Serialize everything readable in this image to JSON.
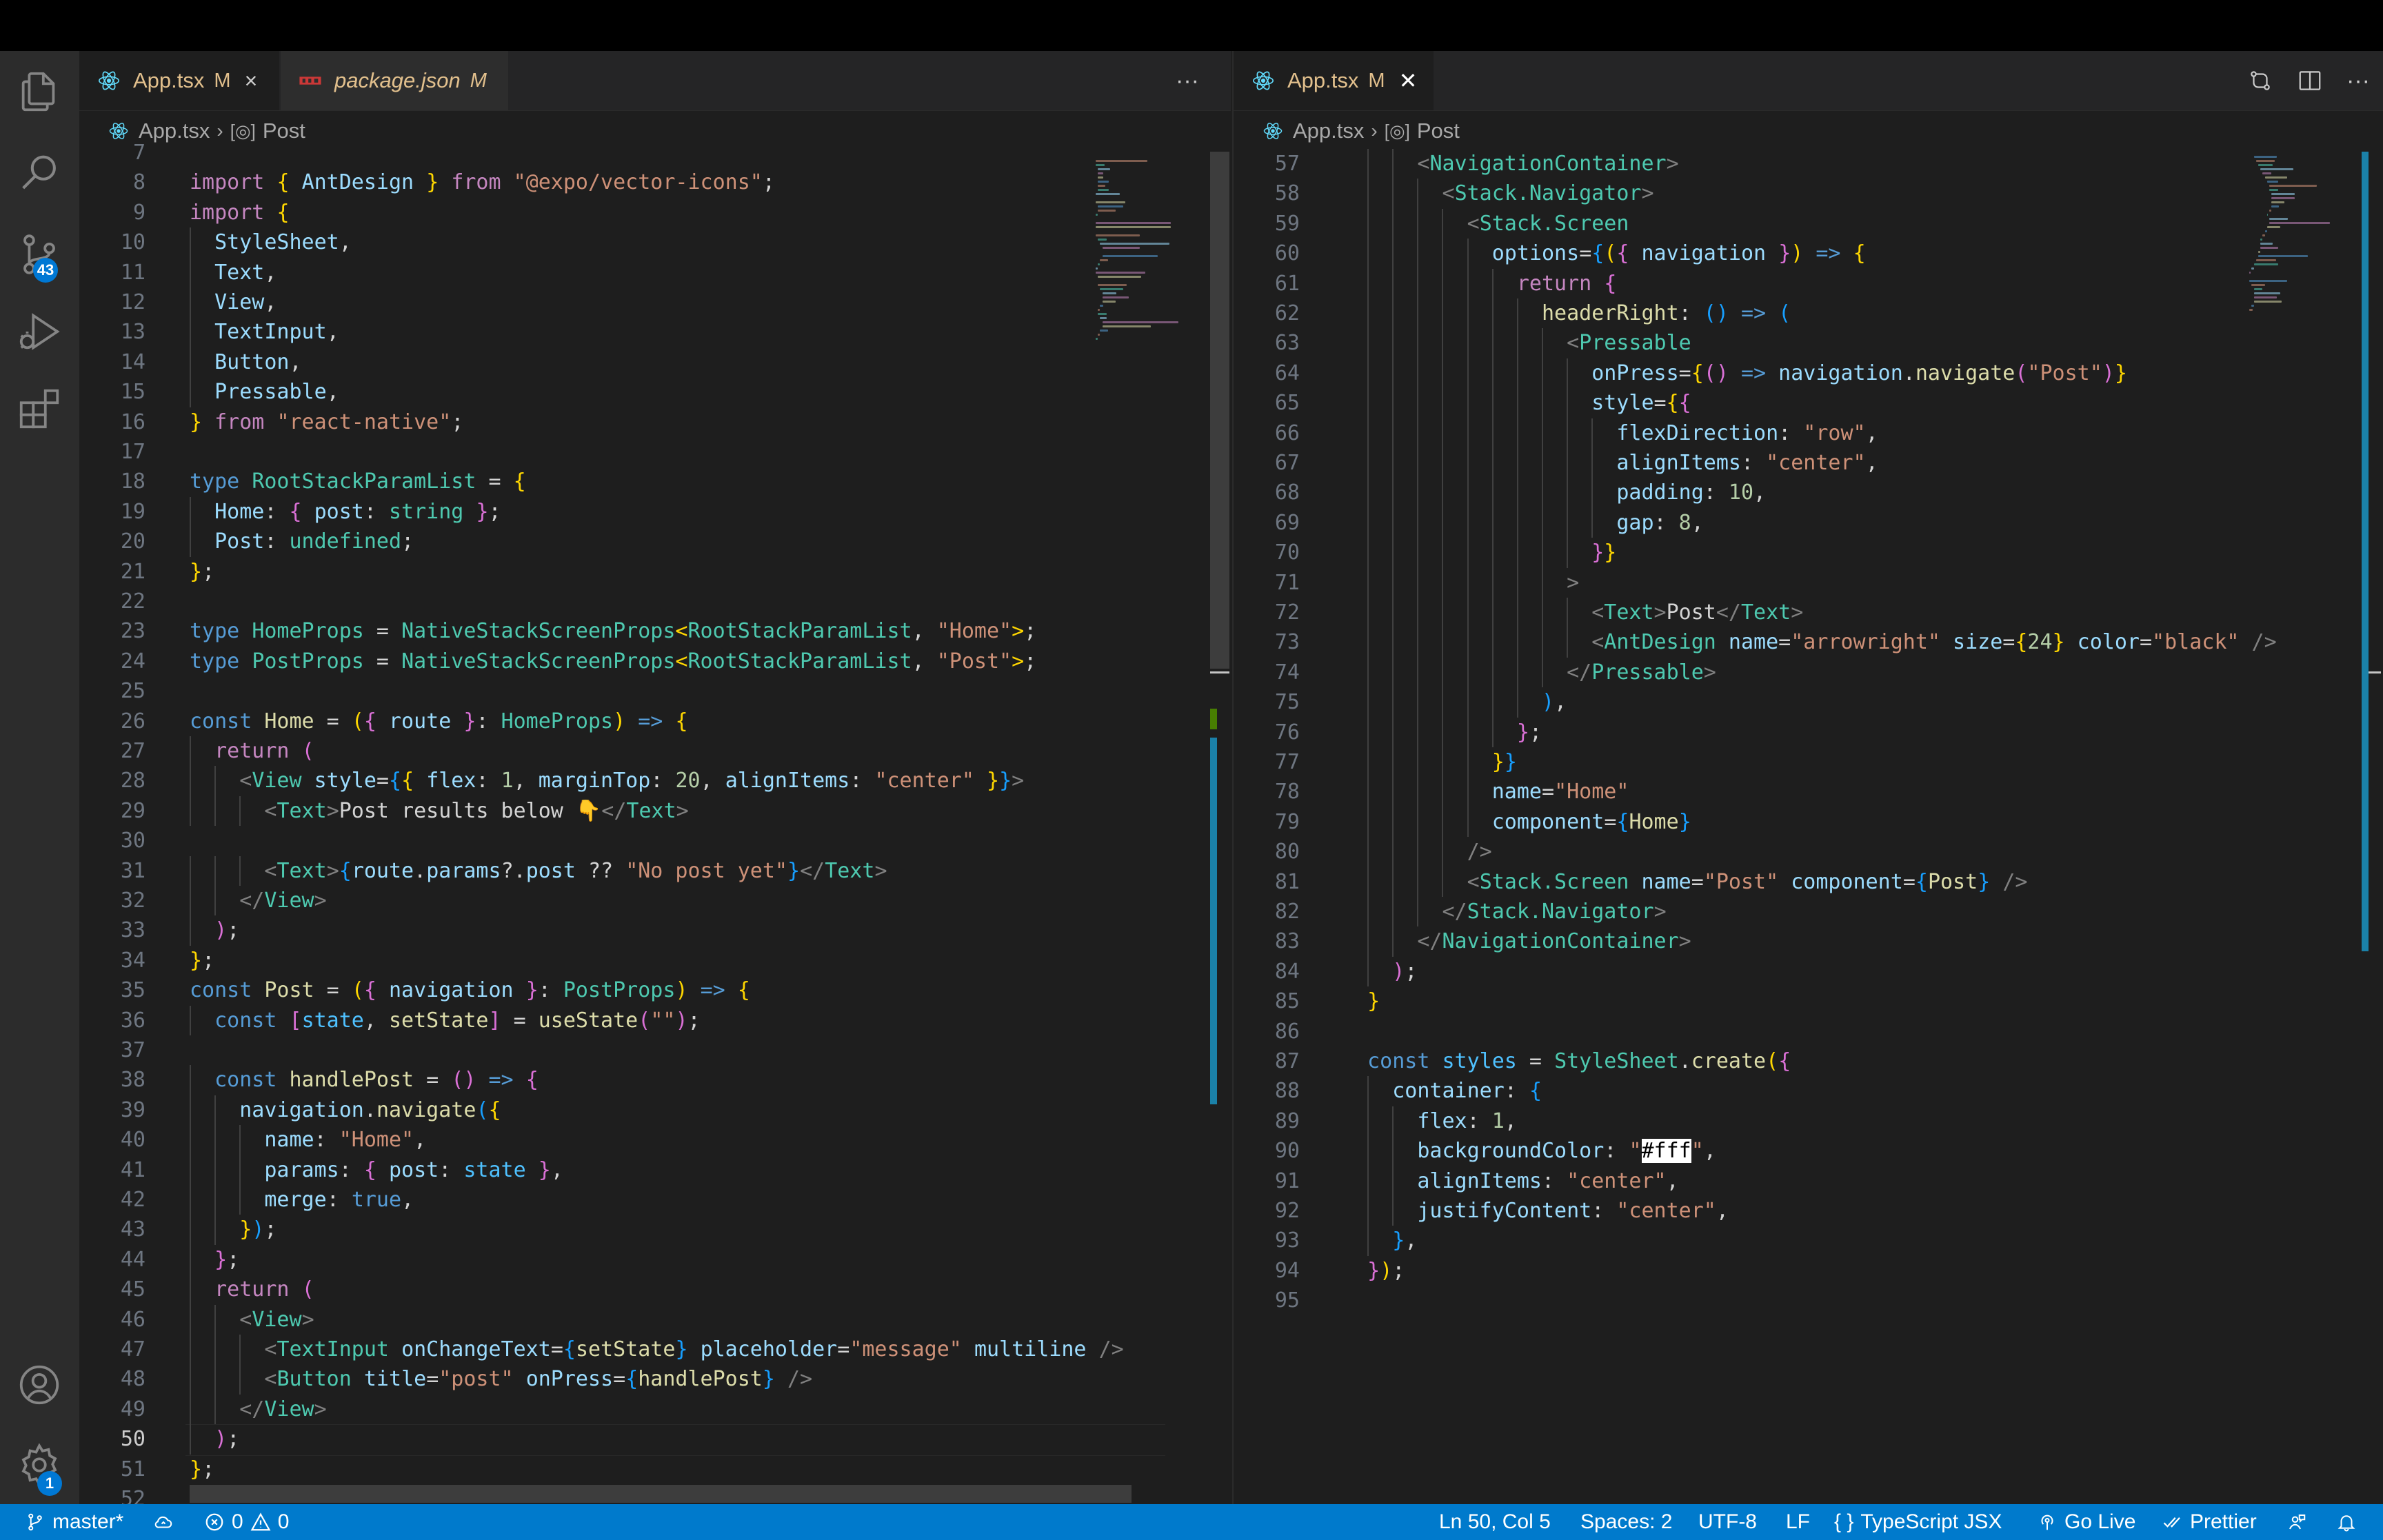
{
  "colors": {
    "accent": "#007acc",
    "modified": "#e2c08d",
    "badge": "#0078d4"
  },
  "activity_bar": {
    "items": [
      {
        "name": "explorer-icon"
      },
      {
        "name": "search-icon"
      },
      {
        "name": "source-control-icon",
        "badge": "43"
      },
      {
        "name": "run-debug-icon"
      },
      {
        "name": "extensions-icon"
      }
    ],
    "bottom": [
      {
        "name": "account-icon"
      },
      {
        "name": "manage-gear-icon",
        "badge": "1"
      }
    ]
  },
  "left_editor": {
    "tabs": [
      {
        "label": "App.tsx",
        "modified": "M",
        "active": true
      },
      {
        "label": "package.json",
        "modified": "M",
        "active": false
      }
    ],
    "more_actions": "···",
    "breadcrumb": {
      "file": "App.tsx",
      "symbol": "Post"
    },
    "current_line": 50,
    "lines": [
      {
        "num": "7",
        "html": ""
      },
      {
        "num": "8",
        "html": "<span class=\"c\">import</span> <span class=\"b1\">{</span> <span class=\"v\">AntDesign</span> <span class=\"b1\">}</span> <span class=\"c\">from</span> <span class=\"s\">\"@expo/vector-icons\"</span>;"
      },
      {
        "num": "9",
        "html": "<span class=\"c\">import</span> <span class=\"b1\">{</span>"
      },
      {
        "num": "10",
        "html": "  <span class=\"v\">StyleSheet</span>,"
      },
      {
        "num": "11",
        "html": "  <span class=\"v\">Text</span>,"
      },
      {
        "num": "12",
        "html": "  <span class=\"v\">View</span>,"
      },
      {
        "num": "13",
        "html": "  <span class=\"v\">TextInput</span>,"
      },
      {
        "num": "14",
        "html": "  <span class=\"v\">Button</span>,"
      },
      {
        "num": "15",
        "html": "  <span class=\"v\">Pressable</span>,"
      },
      {
        "num": "16",
        "html": "<span class=\"b1\">}</span> <span class=\"c\">from</span> <span class=\"s\">\"react-native\"</span>;"
      },
      {
        "num": "17",
        "html": ""
      },
      {
        "num": "18",
        "html": "<span class=\"k\">type</span> <span class=\"t\">RootStackParamList</span> = <span class=\"b1\">{</span>"
      },
      {
        "num": "19",
        "html": "  <span class=\"v\">Home</span>: <span class=\"b2\">{</span> <span class=\"v\">post</span>: <span class=\"t\">string</span> <span class=\"b2\">}</span>;"
      },
      {
        "num": "20",
        "html": "  <span class=\"v\">Post</span>: <span class=\"t\">undefined</span>;"
      },
      {
        "num": "21",
        "html": "<span class=\"b1\">}</span>;"
      },
      {
        "num": "22",
        "html": ""
      },
      {
        "num": "23",
        "html": "<span class=\"k\">type</span> <span class=\"t\">HomeProps</span> = <span class=\"t\">NativeStackScreenProps</span><span class=\"b1\">&lt;</span><span class=\"t\">RootStackParamList</span>, <span class=\"s\">\"Home\"</span><span class=\"b1\">&gt;</span>;"
      },
      {
        "num": "24",
        "html": "<span class=\"k\">type</span> <span class=\"t\">PostProps</span> = <span class=\"t\">NativeStackScreenProps</span><span class=\"b1\">&lt;</span><span class=\"t\">RootStackParamList</span>, <span class=\"s\">\"Post\"</span><span class=\"b1\">&gt;</span>;"
      },
      {
        "num": "25",
        "html": ""
      },
      {
        "num": "26",
        "html": "<span class=\"k\">const</span> <span class=\"f\">Home</span> = <span class=\"b1\">(</span><span class=\"b2\">{</span> <span class=\"v\">route</span> <span class=\"b2\">}</span>: <span class=\"t\">HomeProps</span><span class=\"b1\">)</span> <span class=\"k\">=&gt;</span> <span class=\"b1\">{</span>"
      },
      {
        "num": "27",
        "html": "  <span class=\"c\">return</span> <span class=\"b2\">(</span>"
      },
      {
        "num": "28",
        "html": "    <span class=\"tg\">&lt;</span><span class=\"t\">View</span> <span class=\"v\">style</span>=<span class=\"b3\">{</span><span class=\"b1\">{</span> <span class=\"v\">flex</span>: <span class=\"n\">1</span>, <span class=\"v\">marginTop</span>: <span class=\"n\">20</span>, <span class=\"v\">alignItems</span>: <span class=\"s\">\"center\"</span> <span class=\"b1\">}</span><span class=\"b3\">}</span><span class=\"tg\">&gt;</span>"
      },
      {
        "num": "29",
        "html": "      <span class=\"tg\">&lt;</span><span class=\"t\">Text</span><span class=\"tg\">&gt;</span>Post results below 👇<span class=\"tg\">&lt;/</span><span class=\"t\">Text</span><span class=\"tg\">&gt;</span>"
      },
      {
        "num": "30",
        "html": ""
      },
      {
        "num": "31",
        "html": "      <span class=\"tg\">&lt;</span><span class=\"t\">Text</span><span class=\"tg\">&gt;</span><span class=\"b3\">{</span><span class=\"v\">route</span>.<span class=\"v\">params</span>?.<span class=\"v\">post</span> ?? <span class=\"s\">\"No post yet\"</span><span class=\"b3\">}</span><span class=\"tg\">&lt;/</span><span class=\"t\">Text</span><span class=\"tg\">&gt;</span>"
      },
      {
        "num": "32",
        "html": "    <span class=\"tg\">&lt;/</span><span class=\"t\">View</span><span class=\"tg\">&gt;</span>"
      },
      {
        "num": "33",
        "html": "  <span class=\"b2\">)</span>;"
      },
      {
        "num": "34",
        "html": "<span class=\"b1\">}</span>;"
      },
      {
        "num": "35",
        "html": "<span class=\"k\">const</span> <span class=\"f\">Post</span> = <span class=\"b1\">(</span><span class=\"b2\">{</span> <span class=\"v\">navigation</span> <span class=\"b2\">}</span>: <span class=\"t\">PostProps</span><span class=\"b1\">)</span> <span class=\"k\">=&gt;</span> <span class=\"b1\">{</span>"
      },
      {
        "num": "36",
        "html": "  <span class=\"k\">const</span> <span class=\"b2\">[</span><span class=\"vv\">state</span>, <span class=\"f\">setState</span><span class=\"b2\">]</span> = <span class=\"f\">useState</span><span class=\"b2\">(</span><span class=\"s\">\"\"</span><span class=\"b2\">)</span>;"
      },
      {
        "num": "37",
        "html": ""
      },
      {
        "num": "38",
        "html": "  <span class=\"k\">const</span> <span class=\"f\">handlePost</span> = <span class=\"b2\">()</span> <span class=\"k\">=&gt;</span> <span class=\"b2\">{</span>"
      },
      {
        "num": "39",
        "html": "    <span class=\"v\">navigation</span>.<span class=\"f\">navigate</span><span class=\"b3\">(</span><span class=\"b1\">{</span>"
      },
      {
        "num": "40",
        "html": "      <span class=\"v\">name</span>: <span class=\"s\">\"Home\"</span>,"
      },
      {
        "num": "41",
        "html": "      <span class=\"v\">params</span>: <span class=\"b2\">{</span> <span class=\"v\">post</span>: <span class=\"vv\">state</span> <span class=\"b2\">}</span>,"
      },
      {
        "num": "42",
        "html": "      <span class=\"v\">merge</span>: <span class=\"k\">true</span>,"
      },
      {
        "num": "43",
        "html": "    <span class=\"b1\">}</span><span class=\"b3\">)</span>;"
      },
      {
        "num": "44",
        "html": "  <span class=\"b2\">}</span>;"
      },
      {
        "num": "45",
        "html": "  <span class=\"c\">return</span> <span class=\"b2\">(</span>"
      },
      {
        "num": "46",
        "html": "    <span class=\"tg\">&lt;</span><span class=\"t\">View</span><span class=\"tg\">&gt;</span>"
      },
      {
        "num": "47",
        "html": "      <span class=\"tg\">&lt;</span><span class=\"t\">TextInput</span> <span class=\"v\">onChangeText</span>=<span class=\"b3\">{</span><span class=\"f\">setState</span><span class=\"b3\">}</span> <span class=\"v\">placeholder</span>=<span class=\"s\">\"message\"</span> <span class=\"v\">multiline</span> <span class=\"tg\">/&gt;</span>"
      },
      {
        "num": "48",
        "html": "      <span class=\"tg\">&lt;</span><span class=\"t\">Button</span> <span class=\"v\">title</span>=<span class=\"s\">\"post\"</span> <span class=\"v\">onPress</span>=<span class=\"b3\">{</span><span class=\"f\">handlePost</span><span class=\"b3\">}</span> <span class=\"tg\">/&gt;</span>"
      },
      {
        "num": "49",
        "html": "    <span class=\"tg\">&lt;/</span><span class=\"t\">View</span><span class=\"tg\">&gt;</span>"
      },
      {
        "num": "50",
        "html": "  <span class=\"b2\">)</span>;"
      },
      {
        "num": "51",
        "html": "<span class=\"b1\">}</span>;"
      },
      {
        "num": "52",
        "html": ""
      }
    ]
  },
  "right_editor": {
    "tabs": [
      {
        "label": "App.tsx",
        "modified": "M",
        "active": true
      }
    ],
    "breadcrumb": {
      "file": "App.tsx",
      "symbol": "Post"
    },
    "lines": [
      {
        "num": "57",
        "html": "      <span class=\"tg\">&lt;</span><span class=\"t\">NavigationContainer</span><span class=\"tg\">&gt;</span>"
      },
      {
        "num": "58",
        "html": "        <span class=\"tg\">&lt;</span><span class=\"t\">Stack.Navigator</span><span class=\"tg\">&gt;</span>"
      },
      {
        "num": "59",
        "html": "          <span class=\"tg\">&lt;</span><span class=\"t\">Stack.Screen</span>"
      },
      {
        "num": "60",
        "html": "            <span class=\"v\">options</span>=<span class=\"b3\">{</span><span class=\"b1\">(</span><span class=\"b2\">{</span> <span class=\"v\">navigation</span> <span class=\"b2\">}</span><span class=\"b1\">)</span> <span class=\"k\">=&gt;</span> <span class=\"b1\">{</span>"
      },
      {
        "num": "61",
        "html": "              <span class=\"c\">return</span> <span class=\"b2\">{</span>"
      },
      {
        "num": "62",
        "html": "                <span class=\"f\">headerRight</span>: <span class=\"b3\">()</span> <span class=\"k\">=&gt;</span> <span class=\"b3\">(</span>"
      },
      {
        "num": "63",
        "html": "                  <span class=\"tg\">&lt;</span><span class=\"t\">Pressable</span>"
      },
      {
        "num": "64",
        "html": "                    <span class=\"v\">onPress</span>=<span class=\"b1\">{</span><span class=\"b2\">()</span> <span class=\"k\">=&gt;</span> <span class=\"v\">navigation</span>.<span class=\"f\">navigate</span><span class=\"b2\">(</span><span class=\"s\">\"Post\"</span><span class=\"b2\">)</span><span class=\"b1\">}</span>"
      },
      {
        "num": "65",
        "html": "                    <span class=\"v\">style</span>=<span class=\"b1\">{</span><span class=\"b2\">{</span>"
      },
      {
        "num": "66",
        "html": "                      <span class=\"v\">flexDirection</span>: <span class=\"s\">\"row\"</span>,"
      },
      {
        "num": "67",
        "html": "                      <span class=\"v\">alignItems</span>: <span class=\"s\">\"center\"</span>,"
      },
      {
        "num": "68",
        "html": "                      <span class=\"v\">padding</span>: <span class=\"n\">10</span>,"
      },
      {
        "num": "69",
        "html": "                      <span class=\"v\">gap</span>: <span class=\"n\">8</span>,"
      },
      {
        "num": "70",
        "html": "                    <span class=\"b2\">}</span><span class=\"b1\">}</span>"
      },
      {
        "num": "71",
        "html": "                  <span class=\"tg\">&gt;</span>"
      },
      {
        "num": "72",
        "html": "                    <span class=\"tg\">&lt;</span><span class=\"t\">Text</span><span class=\"tg\">&gt;</span>Post<span class=\"tg\">&lt;/</span><span class=\"t\">Text</span><span class=\"tg\">&gt;</span>"
      },
      {
        "num": "73",
        "html": "                    <span class=\"tg\">&lt;</span><span class=\"t\">AntDesign</span> <span class=\"v\">name</span>=<span class=\"s\">\"arrowright\"</span> <span class=\"v\">size</span>=<span class=\"b1\">{</span><span class=\"n\">24</span><span class=\"b1\">}</span> <span class=\"v\">color</span>=<span class=\"s\">\"black\"</span> <span class=\"tg\">/&gt;</span>"
      },
      {
        "num": "74",
        "html": "                  <span class=\"tg\">&lt;/</span><span class=\"t\">Pressable</span><span class=\"tg\">&gt;</span>"
      },
      {
        "num": "75",
        "html": "                <span class=\"b3\">)</span>,"
      },
      {
        "num": "76",
        "html": "              <span class=\"b2\">}</span>;"
      },
      {
        "num": "77",
        "html": "            <span class=\"b1\">}</span><span class=\"b3\">}</span>"
      },
      {
        "num": "78",
        "html": "            <span class=\"v\">name</span>=<span class=\"s\">\"Home\"</span>"
      },
      {
        "num": "79",
        "html": "            <span class=\"v\">component</span>=<span class=\"b3\">{</span><span class=\"f\">Home</span><span class=\"b3\">}</span>"
      },
      {
        "num": "80",
        "html": "          <span class=\"tg\">/&gt;</span>"
      },
      {
        "num": "81",
        "html": "          <span class=\"tg\">&lt;</span><span class=\"t\">Stack.Screen</span> <span class=\"v\">name</span>=<span class=\"s\">\"Post\"</span> <span class=\"v\">component</span>=<span class=\"b3\">{</span><span class=\"f\">Post</span><span class=\"b3\">}</span> <span class=\"tg\">/&gt;</span>"
      },
      {
        "num": "82",
        "html": "        <span class=\"tg\">&lt;/</span><span class=\"t\">Stack.Navigator</span><span class=\"tg\">&gt;</span>"
      },
      {
        "num": "83",
        "html": "      <span class=\"tg\">&lt;/</span><span class=\"t\">NavigationContainer</span><span class=\"tg\">&gt;</span>"
      },
      {
        "num": "84",
        "html": "    <span class=\"b2\">)</span>;"
      },
      {
        "num": "85",
        "html": "  <span class=\"b1\">}</span>"
      },
      {
        "num": "86",
        "html": ""
      },
      {
        "num": "87",
        "html": "  <span class=\"k\">const</span> <span class=\"vv\">styles</span> = <span class=\"t\">StyleSheet</span>.<span class=\"f\">create</span><span class=\"b1\">(</span><span class=\"b2\">{</span>"
      },
      {
        "num": "88",
        "html": "    <span class=\"v\">container</span>: <span class=\"b3\">{</span>"
      },
      {
        "num": "89",
        "html": "      <span class=\"v\">flex</span>: <span class=\"n\">1</span>,"
      },
      {
        "num": "90",
        "html": "      <span class=\"v\">backgroundColor</span>: <span class=\"s\">\"<span class=\"hl\">#fff</span>\"</span>,"
      },
      {
        "num": "91",
        "html": "      <span class=\"v\">alignItems</span>: <span class=\"s\">\"center\"</span>,"
      },
      {
        "num": "92",
        "html": "      <span class=\"v\">justifyContent</span>: <span class=\"s\">\"center\"</span>,"
      },
      {
        "num": "93",
        "html": "    <span class=\"b3\">}</span>,"
      },
      {
        "num": "94",
        "html": "  <span class=\"b2\">}</span><span class=\"b1\">)</span>;"
      },
      {
        "num": "95",
        "html": ""
      }
    ]
  },
  "status_bar": {
    "branch": "master*",
    "errors": "0",
    "warnings": "0",
    "position": "Ln 50, Col 5",
    "spaces": "Spaces: 2",
    "encoding": "UTF-8",
    "eol": "LF",
    "language": "TypeScript JSX",
    "go_live": "Go Live",
    "prettier": "Prettier"
  }
}
